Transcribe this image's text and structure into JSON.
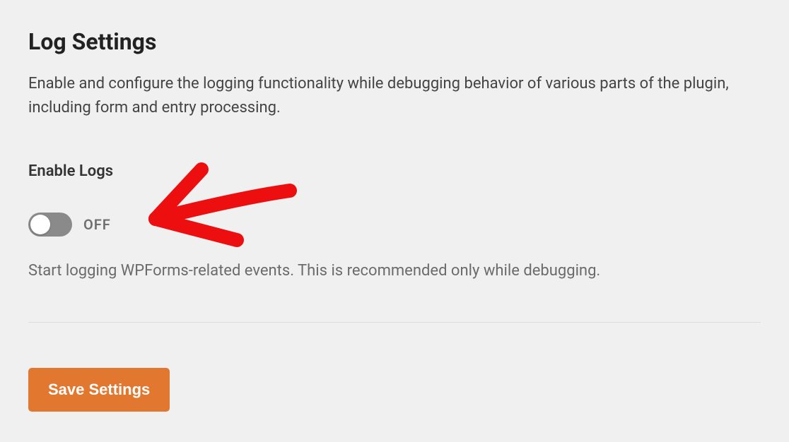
{
  "section": {
    "title": "Log Settings",
    "description": "Enable and configure the logging functionality while debugging behavior of various parts of the plugin, including form and entry processing."
  },
  "enable_logs": {
    "label": "Enable Logs",
    "state_text": "OFF",
    "state": false,
    "help": "Start logging WPForms-related events. This is recommended only while debugging."
  },
  "actions": {
    "save_label": "Save Settings"
  },
  "colors": {
    "accent": "#e27730"
  }
}
